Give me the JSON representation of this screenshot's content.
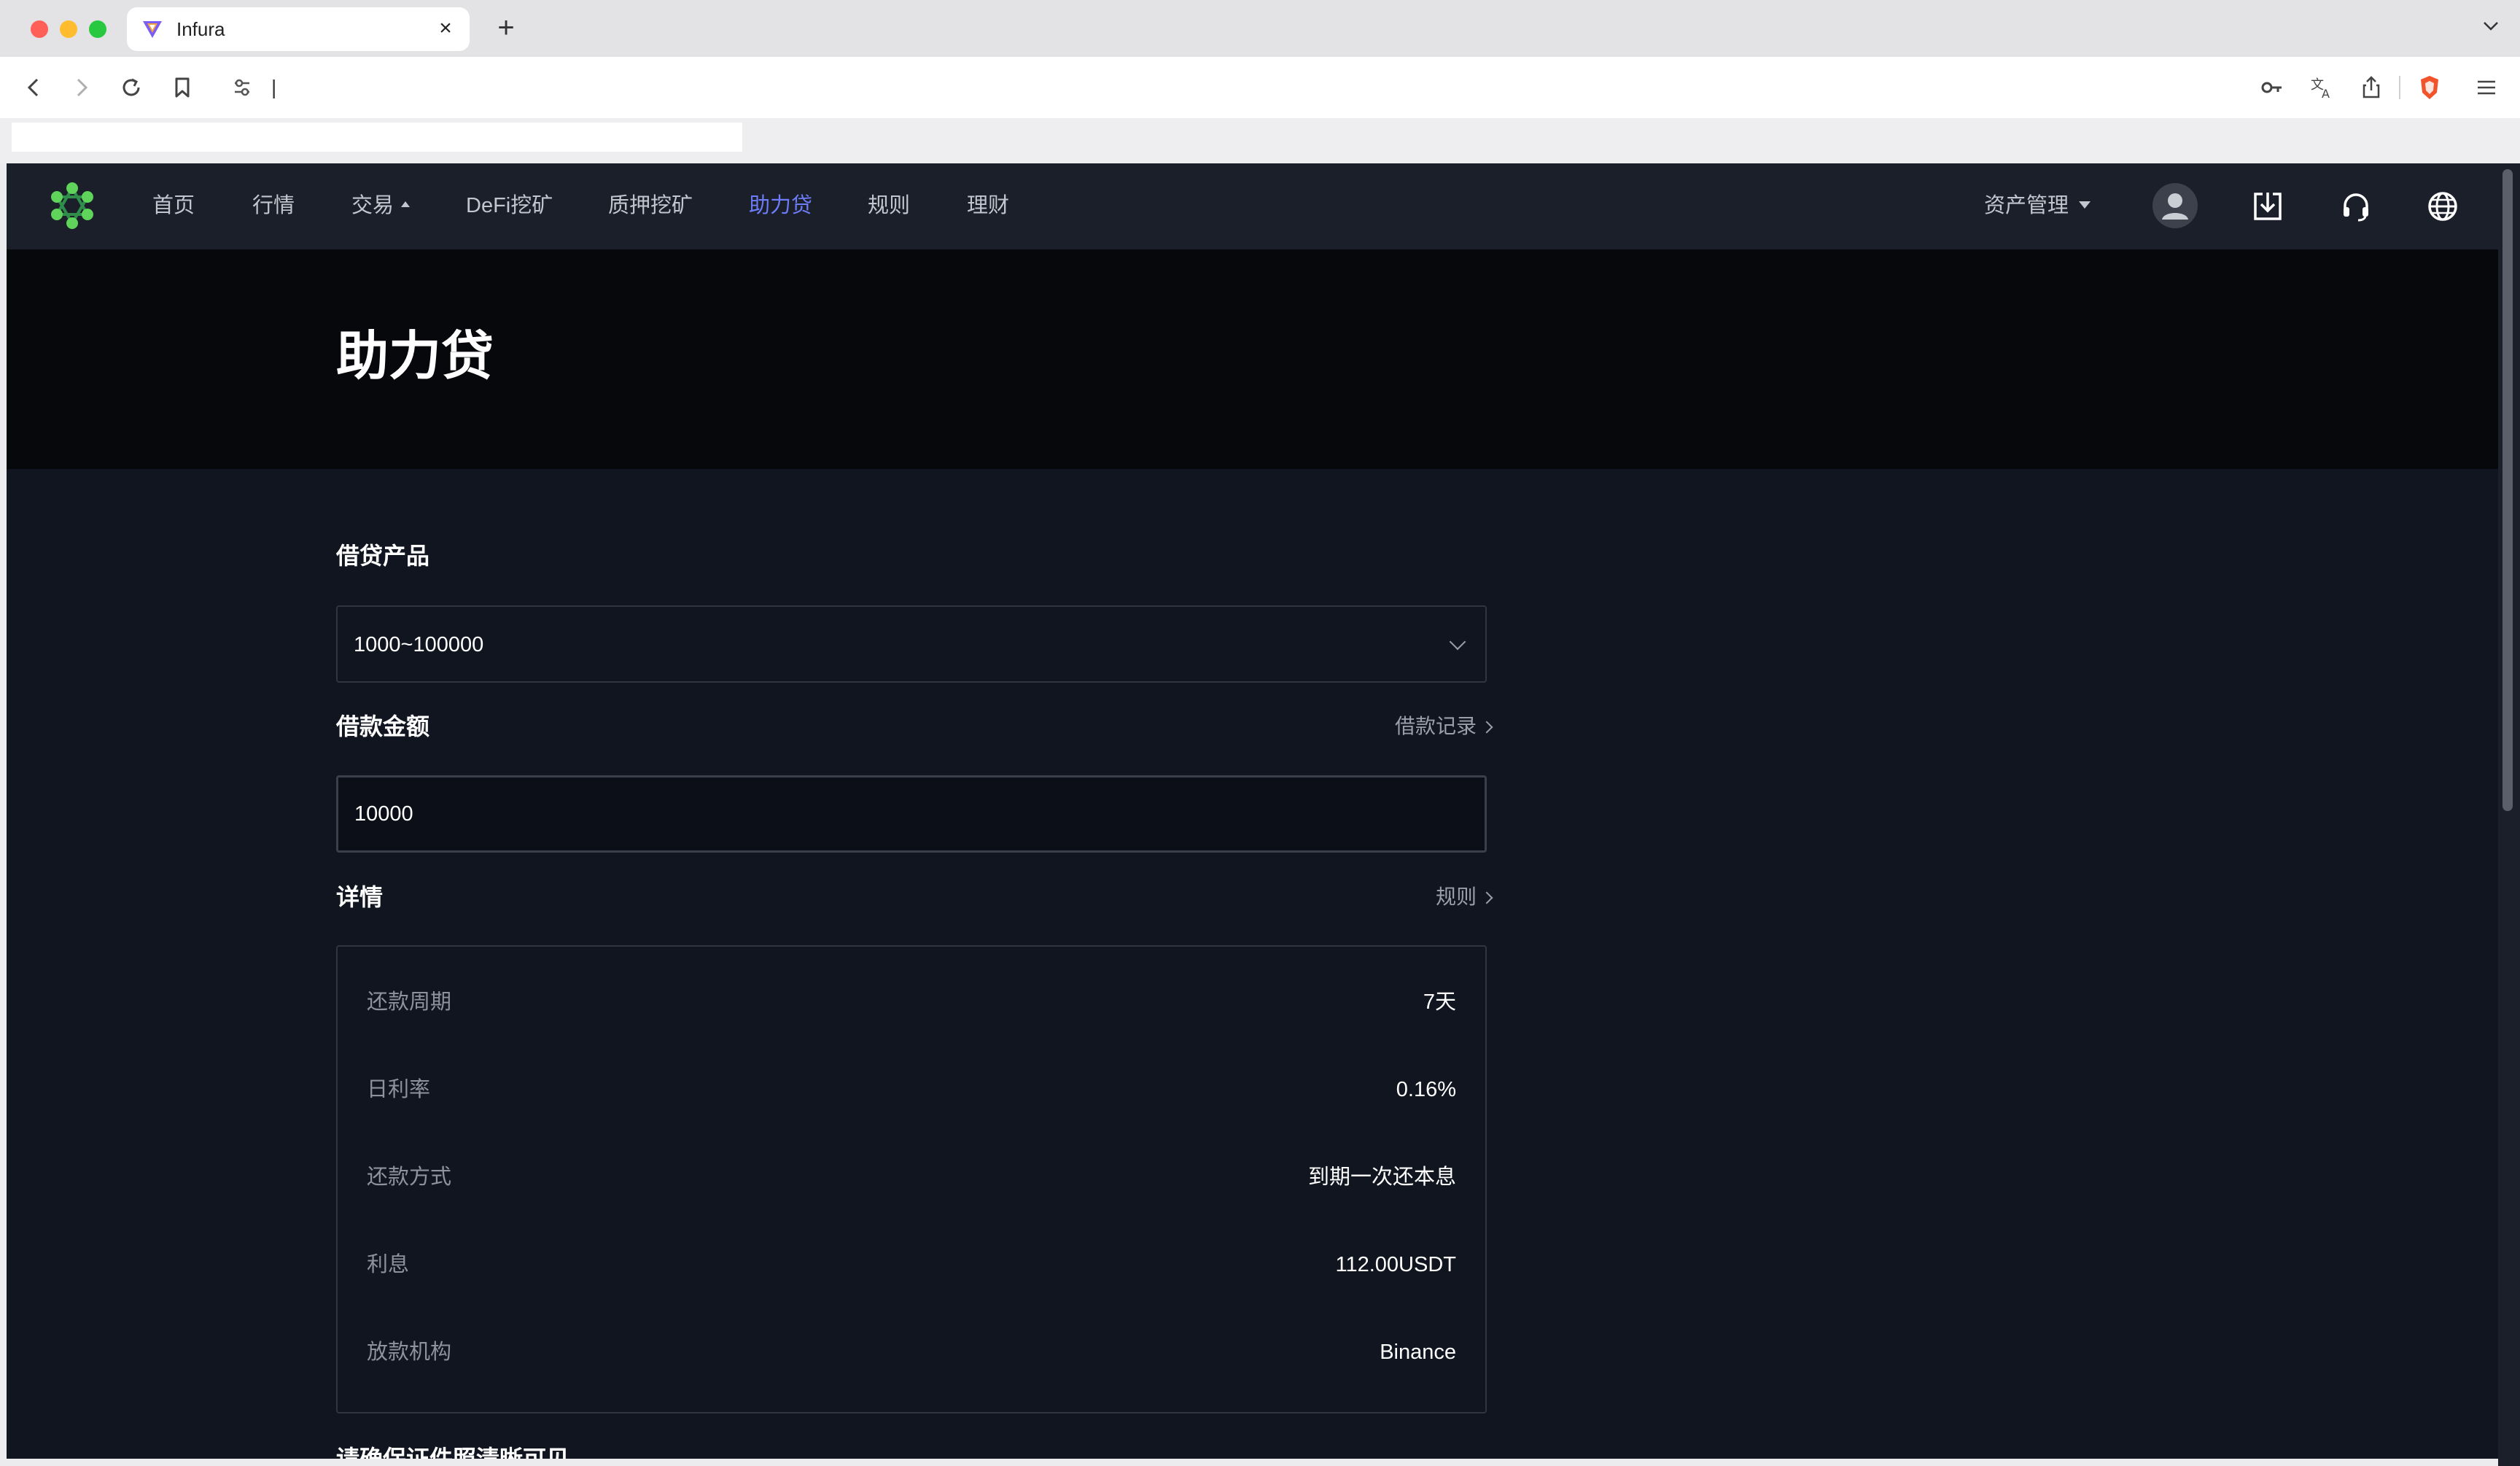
{
  "browser": {
    "tab_title": "Infura",
    "tab_close": "×",
    "new_tab": "+",
    "url": "|"
  },
  "nav": {
    "items": [
      {
        "label": "首页"
      },
      {
        "label": "行情"
      },
      {
        "label": "交易"
      },
      {
        "label": "DeFi挖矿"
      },
      {
        "label": "质押挖矿"
      },
      {
        "label": "助力贷",
        "active": true
      },
      {
        "label": "规则"
      },
      {
        "label": "理财"
      }
    ],
    "asset_menu": "资产管理"
  },
  "hero": {
    "title": "助力贷"
  },
  "form": {
    "product_label": "借贷产品",
    "product_value": "1000~100000",
    "amount_label": "借款金额",
    "amount_value": "10000",
    "loan_records_link": "借款记录",
    "details_label": "详情",
    "rules_link": "规则",
    "details": [
      {
        "label": "还款周期",
        "value": "7天"
      },
      {
        "label": "日利率",
        "value": "0.16%"
      },
      {
        "label": "还款方式",
        "value": "到期一次还本息"
      },
      {
        "label": "利息",
        "value": "112.00USDT"
      },
      {
        "label": "放款机构",
        "value": "Binance"
      }
    ],
    "next_section_label": "请确保证件照清晰可见"
  },
  "colors": {
    "page_bg": "#111520",
    "navbar_bg": "#1b1f2a",
    "hero_bg": "#07080c",
    "accent": "#6d7cf7"
  }
}
